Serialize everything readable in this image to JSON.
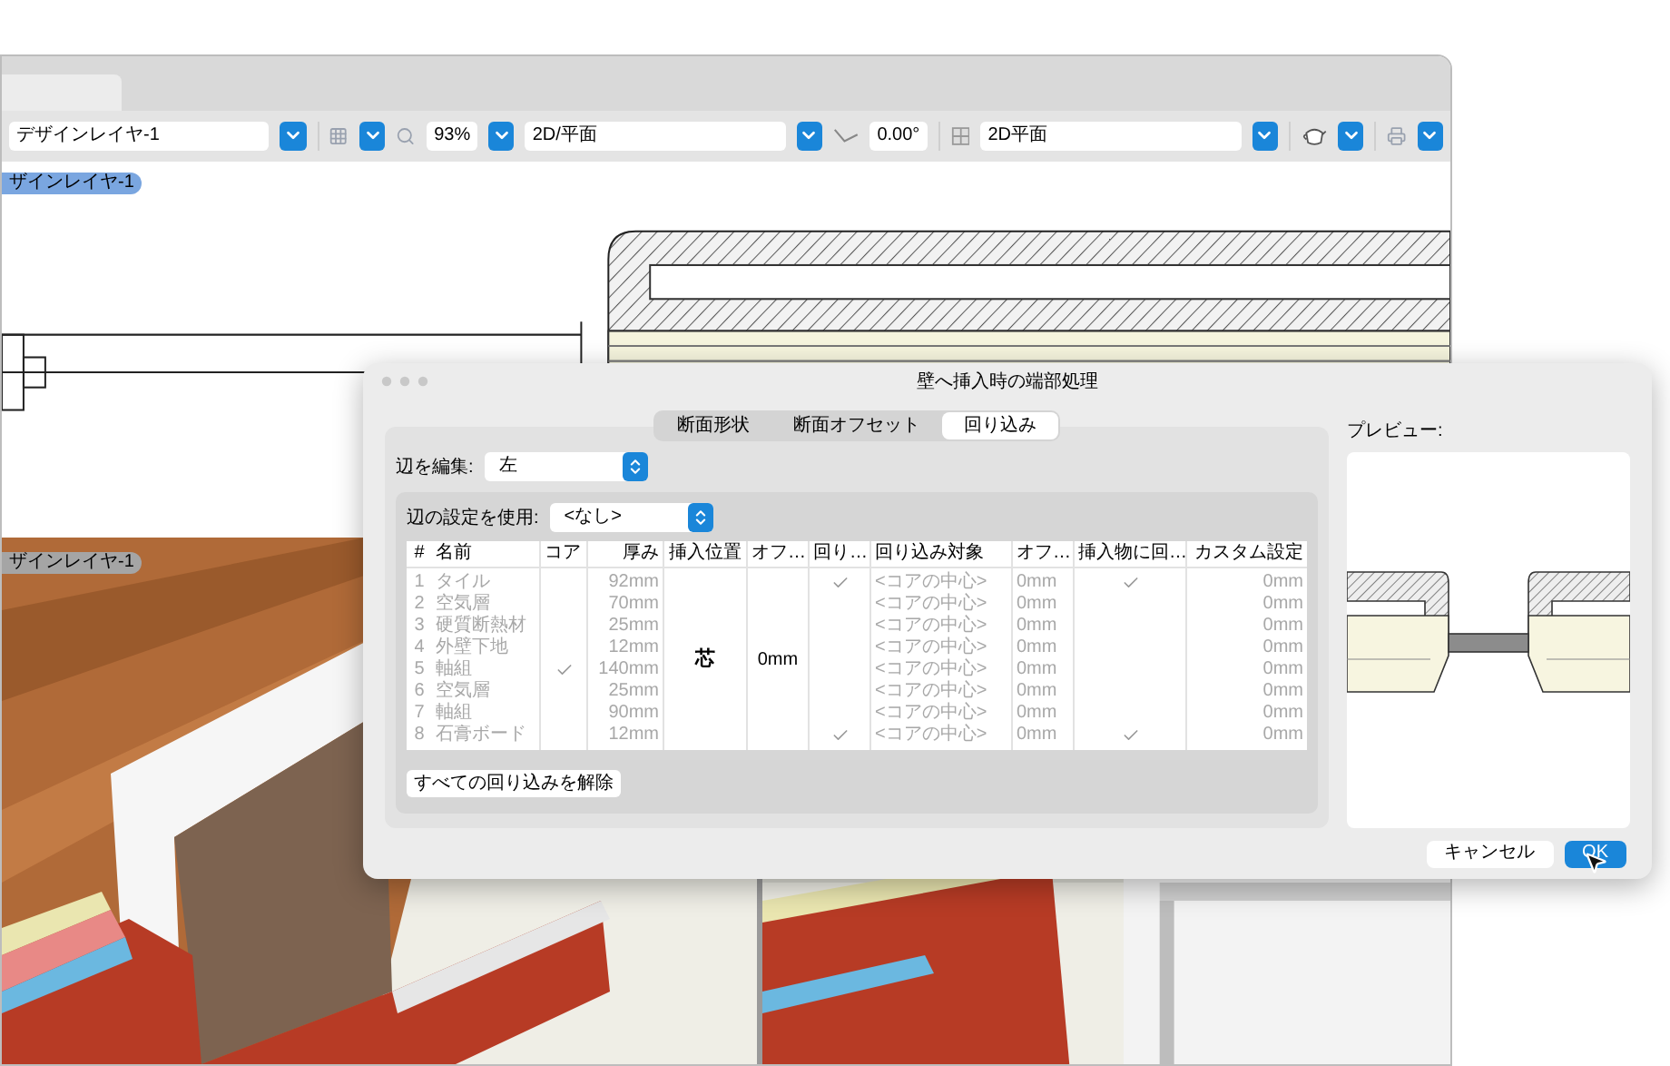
{
  "app": {
    "toolbar": {
      "layer": "デザインレイヤ-1",
      "zoom": "93%",
      "view": "2D/平面",
      "angle": "0.00°",
      "render_mode": "2D平面"
    },
    "drawing": {
      "layer_label": "ザインレイヤ-1"
    },
    "viewport": {
      "layer_label": "ザインレイヤ-1"
    }
  },
  "dialog": {
    "title": "壁へ挿入時の端部処理",
    "tabs": [
      {
        "label": "断面形状",
        "selected": false
      },
      {
        "label": "断面オフセット",
        "selected": false
      },
      {
        "label": "回り込み",
        "selected": true
      }
    ],
    "edit_edge": {
      "label": "辺を編集:",
      "value": "左"
    },
    "edge_setting": {
      "label": "辺の設定を使用:",
      "value": "<なし>"
    },
    "table": {
      "columns": [
        "#",
        "名前",
        "コア",
        "厚み",
        "挿入位置",
        "オフ…",
        "回り…",
        "回り込み対象",
        "オフ…",
        "挿入物に回…",
        "カスタム設定"
      ],
      "insert_position": "芯",
      "offset": "0mm",
      "rows": [
        {
          "number": "1",
          "name": "タイル",
          "core": false,
          "thickness": "92mm",
          "wrap": true,
          "target": "<コアの中心>",
          "target_offset": "0mm",
          "wrap_insert": true,
          "custom": "0mm"
        },
        {
          "number": "2",
          "name": "空気層",
          "core": false,
          "thickness": "70mm",
          "wrap": false,
          "target": "<コアの中心>",
          "target_offset": "0mm",
          "wrap_insert": false,
          "custom": "0mm"
        },
        {
          "number": "3",
          "name": "硬質断熱材",
          "core": false,
          "thickness": "25mm",
          "wrap": false,
          "target": "<コアの中心>",
          "target_offset": "0mm",
          "wrap_insert": false,
          "custom": "0mm"
        },
        {
          "number": "4",
          "name": "外壁下地",
          "core": false,
          "thickness": "12mm",
          "wrap": false,
          "target": "<コアの中心>",
          "target_offset": "0mm",
          "wrap_insert": false,
          "custom": "0mm"
        },
        {
          "number": "5",
          "name": "軸組",
          "core": true,
          "thickness": "140mm",
          "wrap": false,
          "target": "<コアの中心>",
          "target_offset": "0mm",
          "wrap_insert": false,
          "custom": "0mm"
        },
        {
          "number": "6",
          "name": "空気層",
          "core": false,
          "thickness": "25mm",
          "wrap": false,
          "target": "<コアの中心>",
          "target_offset": "0mm",
          "wrap_insert": false,
          "custom": "0mm"
        },
        {
          "number": "7",
          "name": "軸組",
          "core": false,
          "thickness": "90mm",
          "wrap": false,
          "target": "<コアの中心>",
          "target_offset": "0mm",
          "wrap_insert": false,
          "custom": "0mm"
        },
        {
          "number": "8",
          "name": "石膏ボード",
          "core": false,
          "thickness": "12mm",
          "wrap": true,
          "target": "<コアの中心>",
          "target_offset": "0mm",
          "wrap_insert": true,
          "custom": "0mm"
        }
      ]
    },
    "clear_button": "すべての回り込みを解除",
    "preview_label": "プレビュー:",
    "buttons": [
      {
        "label": "キャンセル",
        "kind": "secondary"
      },
      {
        "label": "OK",
        "kind": "primary"
      }
    ]
  }
}
